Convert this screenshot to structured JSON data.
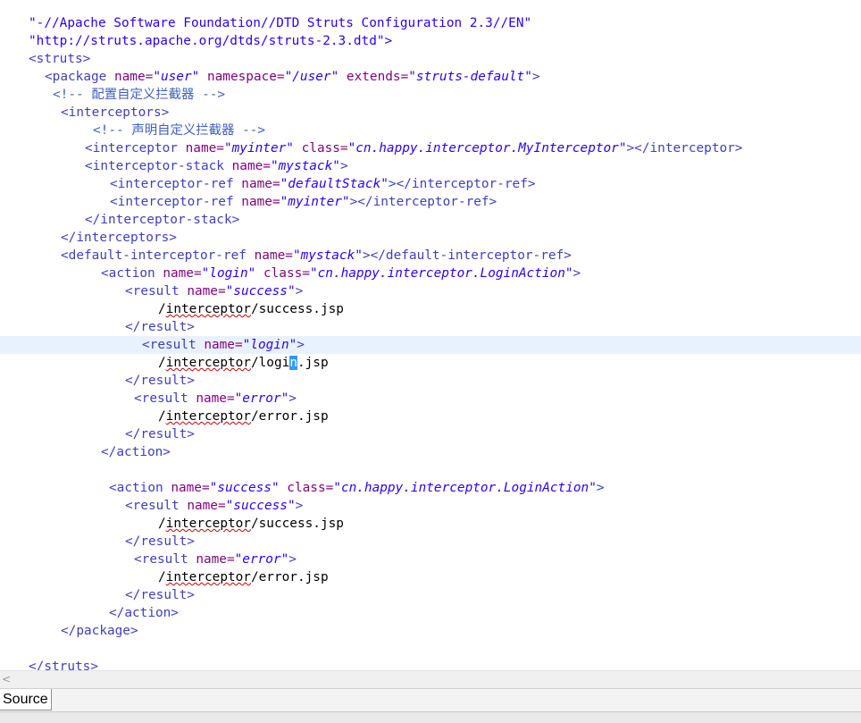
{
  "editor": {
    "cursor_line": 19,
    "lines": [
      [
        [
          "",
          ""
        ]
      ],
      [
        [
          "dt",
          "\"-//Apache Software Foundation//DTD Struts Configuration 2.3//EN\""
        ]
      ],
      [
        [
          "dt",
          "\"http://struts.apache.org/dtds/struts-2.3.dtd\">"
        ]
      ],
      [
        [
          "tag",
          "<struts>"
        ]
      ],
      [
        [
          "tag",
          "<package "
        ],
        [
          "an",
          "name="
        ],
        [
          "av",
          "\"user\""
        ],
        [
          "an",
          " namespace="
        ],
        [
          "av",
          "\"/user\""
        ],
        [
          "an",
          " extends="
        ],
        [
          "av",
          "\"struts-default\""
        ],
        [
          "tag",
          ">"
        ]
      ],
      [
        [
          "cm",
          "<!-- 配置自定义拦截器 -->"
        ]
      ],
      [
        [
          "tag",
          "<interceptors>"
        ]
      ],
      [
        [
          "cm",
          "<!-- 声明自定义拦截器 -->"
        ]
      ],
      [
        [
          "tag",
          "<interceptor "
        ],
        [
          "an",
          "name="
        ],
        [
          "av",
          "\"myinter\""
        ],
        [
          "an",
          " class="
        ],
        [
          "av",
          "\"cn.happy.interceptor.MyInterceptor\""
        ],
        [
          "tag",
          "></interceptor>"
        ]
      ],
      [
        [
          "tag",
          "<interceptor-stack "
        ],
        [
          "an",
          "name="
        ],
        [
          "av",
          "\"mystack\""
        ],
        [
          "tag",
          ">"
        ]
      ],
      [
        [
          "tag",
          "<interceptor-ref "
        ],
        [
          "an",
          "name="
        ],
        [
          "av",
          "\"defaultStack\""
        ],
        [
          "tag",
          "></interceptor-ref>"
        ]
      ],
      [
        [
          "tag",
          "<interceptor-ref "
        ],
        [
          "an",
          "name="
        ],
        [
          "av",
          "\"myinter\""
        ],
        [
          "tag",
          "></interceptor-ref>"
        ]
      ],
      [
        [
          "tag",
          "</interceptor-stack>"
        ]
      ],
      [
        [
          "tag",
          "</interceptors>"
        ]
      ],
      [
        [
          "tag",
          "<default-interceptor-ref "
        ],
        [
          "an",
          "name="
        ],
        [
          "av",
          "\"mystack\""
        ],
        [
          "tag",
          "></default-interceptor-ref>"
        ]
      ],
      [
        [
          "tag",
          "<action "
        ],
        [
          "an",
          "name="
        ],
        [
          "av",
          "\"login\""
        ],
        [
          "an",
          " class="
        ],
        [
          "av",
          "\"cn.happy.interceptor.LoginAction\""
        ],
        [
          "tag",
          ">"
        ]
      ],
      [
        [
          "tag",
          "<result "
        ],
        [
          "an",
          "name="
        ],
        [
          "av",
          "\"success\""
        ],
        [
          "tag",
          ">"
        ]
      ],
      [
        [
          "tx",
          "/"
        ],
        [
          "sq",
          "interceptor"
        ],
        [
          "tx",
          "/success.jsp"
        ]
      ],
      [
        [
          "tag",
          "</result>"
        ]
      ],
      [
        [
          "tag",
          "<result "
        ],
        [
          "an",
          "name="
        ],
        [
          "av",
          "\"login\""
        ],
        [
          "tag",
          ">"
        ]
      ],
      [
        [
          "tx",
          "/"
        ],
        [
          "sq",
          "interceptor"
        ],
        [
          "tx",
          "/logi"
        ],
        [
          "caret",
          "n"
        ],
        [
          "tx",
          ".jsp"
        ]
      ],
      [
        [
          "tag",
          "</result>"
        ]
      ],
      [
        [
          "tag",
          "<result "
        ],
        [
          "an",
          "name="
        ],
        [
          "av",
          "\"error\""
        ],
        [
          "tag",
          ">"
        ]
      ],
      [
        [
          "tx",
          "/"
        ],
        [
          "sq",
          "interceptor"
        ],
        [
          "tx",
          "/error.jsp"
        ]
      ],
      [
        [
          "tag",
          "</result>"
        ]
      ],
      [
        [
          "tag",
          "</action>"
        ]
      ],
      [
        [
          "",
          ""
        ]
      ],
      [
        [
          "tag",
          "<action "
        ],
        [
          "an",
          "name="
        ],
        [
          "av",
          "\"success\""
        ],
        [
          "an",
          " class="
        ],
        [
          "av",
          "\"cn.happy.interceptor.LoginAction\""
        ],
        [
          "tag",
          ">"
        ]
      ],
      [
        [
          "tag",
          "<result "
        ],
        [
          "an",
          "name="
        ],
        [
          "av",
          "\"success\""
        ],
        [
          "tag",
          ">"
        ]
      ],
      [
        [
          "tx",
          "/"
        ],
        [
          "sq",
          "interceptor"
        ],
        [
          "tx",
          "/success.jsp"
        ]
      ],
      [
        [
          "tag",
          "</result>"
        ]
      ],
      [
        [
          "tag",
          "<result "
        ],
        [
          "an",
          "name="
        ],
        [
          "av",
          "\"error\""
        ],
        [
          "tag",
          ">"
        ]
      ],
      [
        [
          "tx",
          "/"
        ],
        [
          "sq",
          "interceptor"
        ],
        [
          "tx",
          "/error.jsp"
        ]
      ],
      [
        [
          "tag",
          "</result>"
        ]
      ],
      [
        [
          "tag",
          "</action>"
        ]
      ],
      [
        [
          "tag",
          "</package>"
        ]
      ],
      [
        [
          "",
          ""
        ]
      ],
      [
        [
          "tag",
          "</struts>"
        ]
      ]
    ]
  },
  "tabs": {
    "source_label": "Source"
  },
  "scroll": {
    "left_arrow": "<"
  }
}
